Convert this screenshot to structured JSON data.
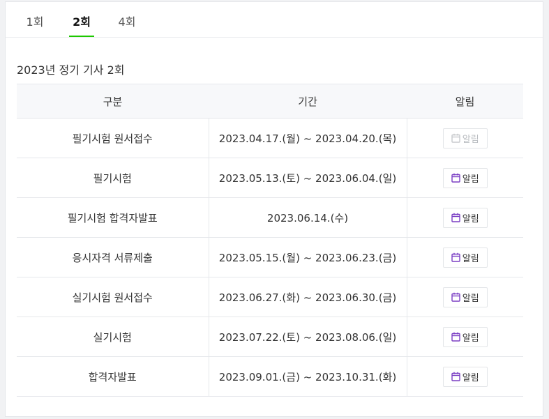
{
  "tabs": [
    {
      "label": "1회",
      "active": false
    },
    {
      "label": "2회",
      "active": true
    },
    {
      "label": "4회",
      "active": false
    }
  ],
  "section_title": "2023년 정기 기사 2회",
  "table": {
    "headers": [
      "구분",
      "기간",
      "알림"
    ],
    "rows": [
      {
        "name": "필기시험 원서접수",
        "period": "2023.04.17.(월) ~ 2023.04.20.(목)",
        "alarm_label": "알림",
        "alarm_enabled": false
      },
      {
        "name": "필기시험",
        "period": "2023.05.13.(토) ~ 2023.06.04.(일)",
        "alarm_label": "알림",
        "alarm_enabled": true
      },
      {
        "name": "필기시험 합격자발표",
        "period": "2023.06.14.(수)",
        "alarm_label": "알림",
        "alarm_enabled": true
      },
      {
        "name": "응시자격 서류제출",
        "period": "2023.05.15.(월) ~ 2023.06.23.(금)",
        "alarm_label": "알림",
        "alarm_enabled": true
      },
      {
        "name": "실기시험 원서접수",
        "period": "2023.06.27.(화) ~ 2023.06.30.(금)",
        "alarm_label": "알림",
        "alarm_enabled": true
      },
      {
        "name": "실기시험",
        "period": "2023.07.22.(토) ~ 2023.08.06.(일)",
        "alarm_label": "알림",
        "alarm_enabled": true
      },
      {
        "name": "합격자발표",
        "period": "2023.09.01.(금) ~ 2023.10.31.(화)",
        "alarm_label": "알림",
        "alarm_enabled": true
      }
    ]
  },
  "icons": {
    "alarm": "calendar-icon"
  },
  "colors": {
    "active_tab_underline": "#1ec800",
    "calendar_icon_enabled": "#7b3fc4",
    "calendar_icon_disabled": "#c8cacd",
    "header_bg": "#f7f8fa"
  }
}
